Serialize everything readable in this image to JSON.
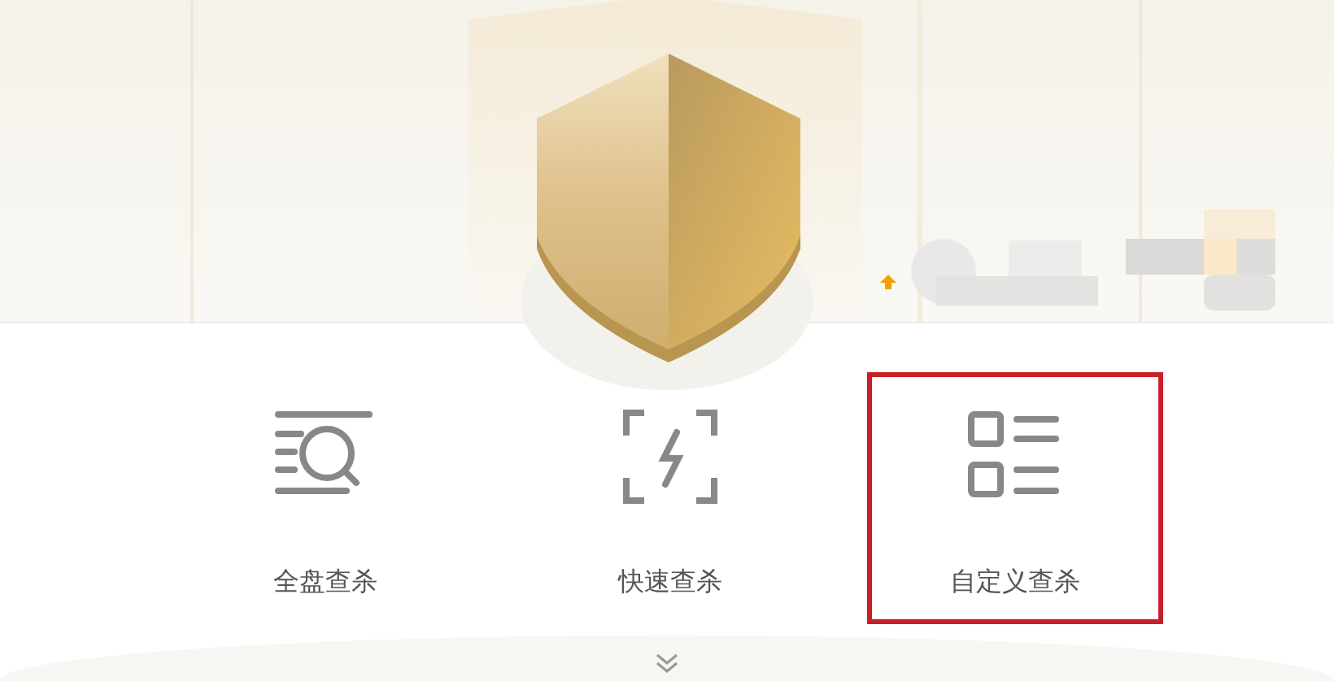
{
  "scan_options": [
    {
      "kind": "full",
      "label": "全盘查杀",
      "highlighted": false
    },
    {
      "kind": "quick",
      "label": "快速查杀",
      "highlighted": false
    },
    {
      "kind": "custom",
      "label": "自定义查杀",
      "highlighted": true
    }
  ]
}
